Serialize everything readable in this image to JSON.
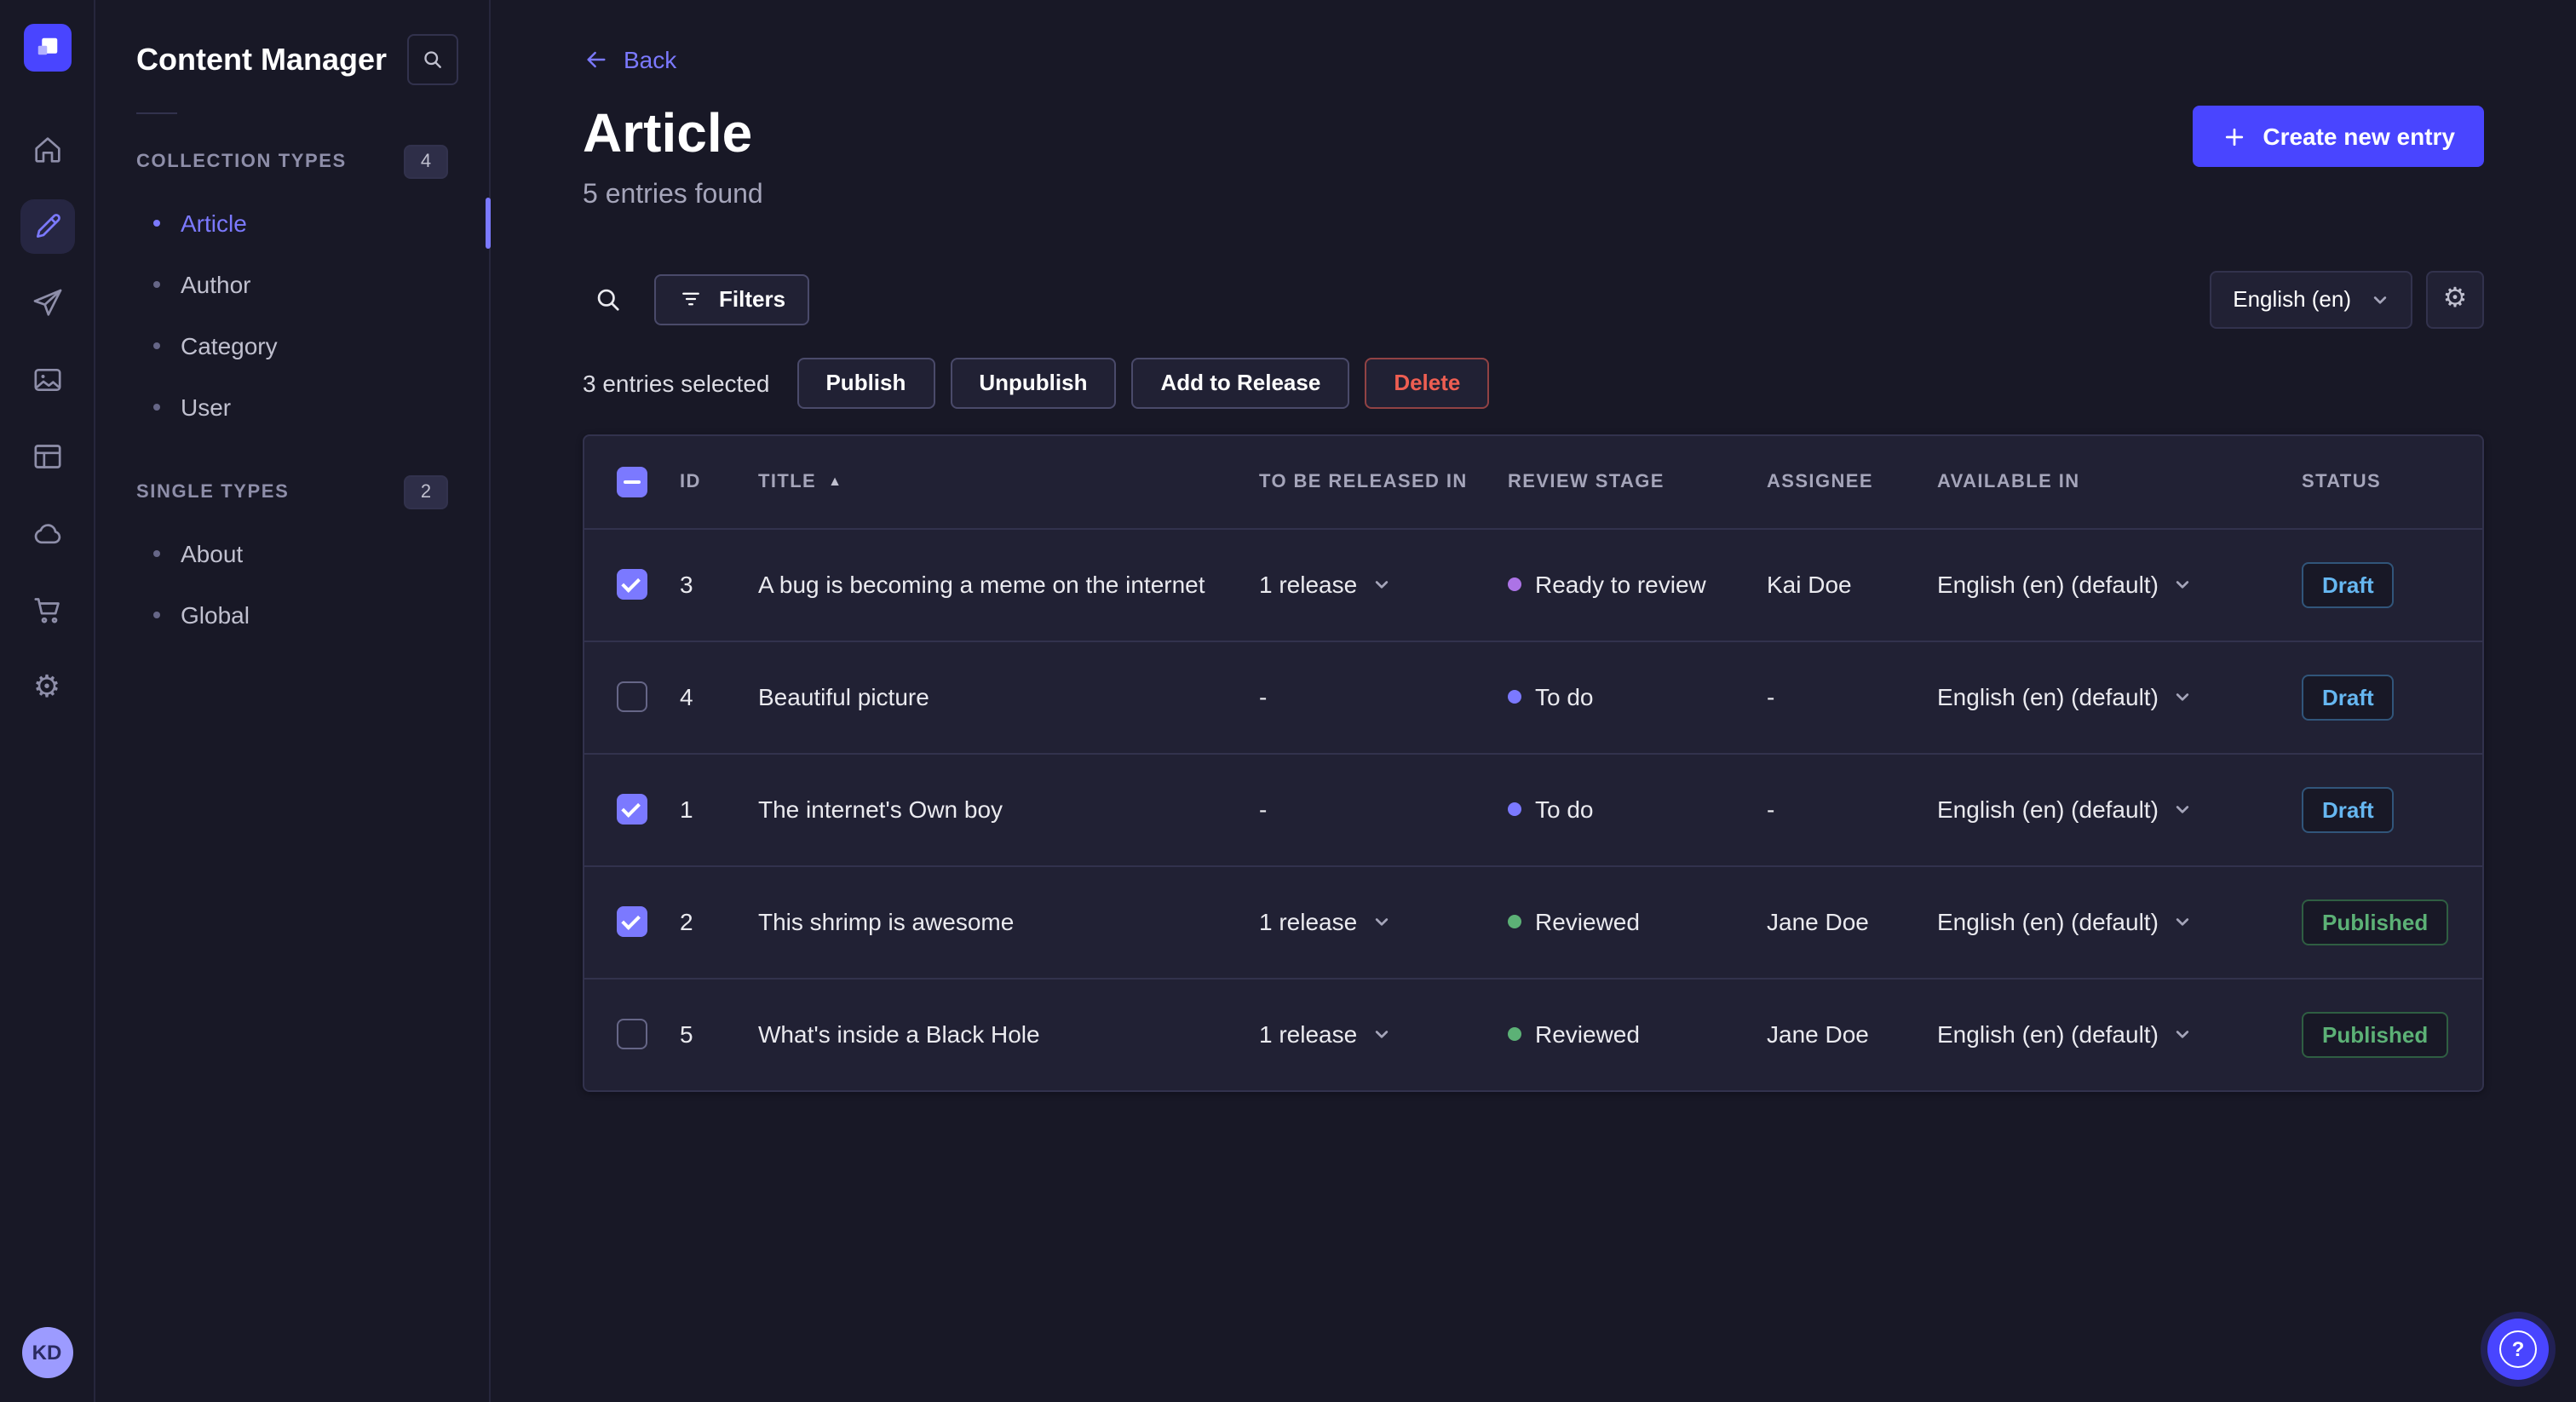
{
  "colors": {
    "accent": "#4945ff",
    "accent_light": "#7b79ff",
    "danger": "#ee5e52",
    "success": "#5cb176",
    "draft_blue": "#66b7f1",
    "stage_ready_to_review": "#ac73e6",
    "stage_to_do": "#7b79ff",
    "stage_reviewed": "#5cb176"
  },
  "rail": {
    "icons": [
      "strapi-logo",
      "home",
      "content-manager",
      "releases",
      "media-library",
      "content-type-builder",
      "deploy",
      "marketplace",
      "settings"
    ],
    "active_item": "content-manager",
    "avatar_initials": "KD",
    "help_label": "?"
  },
  "subnav": {
    "title": "Content Manager",
    "sections": [
      {
        "label": "COLLECTION TYPES",
        "badge": "4",
        "items": [
          {
            "label": "Article",
            "active": true
          },
          {
            "label": "Author",
            "active": false
          },
          {
            "label": "Category",
            "active": false
          },
          {
            "label": "User",
            "active": false
          }
        ]
      },
      {
        "label": "SINGLE TYPES",
        "badge": "2",
        "items": [
          {
            "label": "About",
            "active": false
          },
          {
            "label": "Global",
            "active": false
          }
        ]
      }
    ]
  },
  "header": {
    "back_label": "Back",
    "title": "Article",
    "subtitle": "5 entries found",
    "create_button_label": "Create new entry"
  },
  "toolbar": {
    "filters_label": "Filters",
    "locale_selected": "English (en)"
  },
  "selection": {
    "label": "3 entries selected",
    "publish_label": "Publish",
    "unpublish_label": "Unpublish",
    "add_to_release_label": "Add to Release",
    "delete_label": "Delete"
  },
  "table": {
    "select_all_state": "indeterminate",
    "sort": {
      "column": "TITLE",
      "direction": "ascending"
    },
    "columns": [
      "ID",
      "TITLE",
      "TO BE RELEASED IN",
      "REVIEW STAGE",
      "ASSIGNEE",
      "AVAILABLE IN",
      "STATUS"
    ],
    "rows": [
      {
        "checked": true,
        "id": "3",
        "title": "A bug is becoming a meme on the internet",
        "release": "1 release",
        "stage": "Ready to review",
        "stage_color": "#ac73e6",
        "assignee": "Kai Doe",
        "locale": "English (en) (default)",
        "status": "Draft"
      },
      {
        "checked": false,
        "id": "4",
        "title": "Beautiful picture",
        "release": "-",
        "stage": "To do",
        "stage_color": "#7b79ff",
        "assignee": "-",
        "locale": "English (en) (default)",
        "status": "Draft"
      },
      {
        "checked": true,
        "id": "1",
        "title": "The internet's Own boy",
        "release": "-",
        "stage": "To do",
        "stage_color": "#7b79ff",
        "assignee": "-",
        "locale": "English (en) (default)",
        "status": "Draft"
      },
      {
        "checked": true,
        "id": "2",
        "title": "This shrimp is awesome",
        "release": "1 release",
        "stage": "Reviewed",
        "stage_color": "#5cb176",
        "assignee": "Jane Doe",
        "locale": "English (en) (default)",
        "status": "Published"
      },
      {
        "checked": false,
        "id": "5",
        "title": "What's inside a Black Hole",
        "release": "1 release",
        "stage": "Reviewed",
        "stage_color": "#5cb176",
        "assignee": "Jane Doe",
        "locale": "English (en) (default)",
        "status": "Published"
      }
    ]
  }
}
